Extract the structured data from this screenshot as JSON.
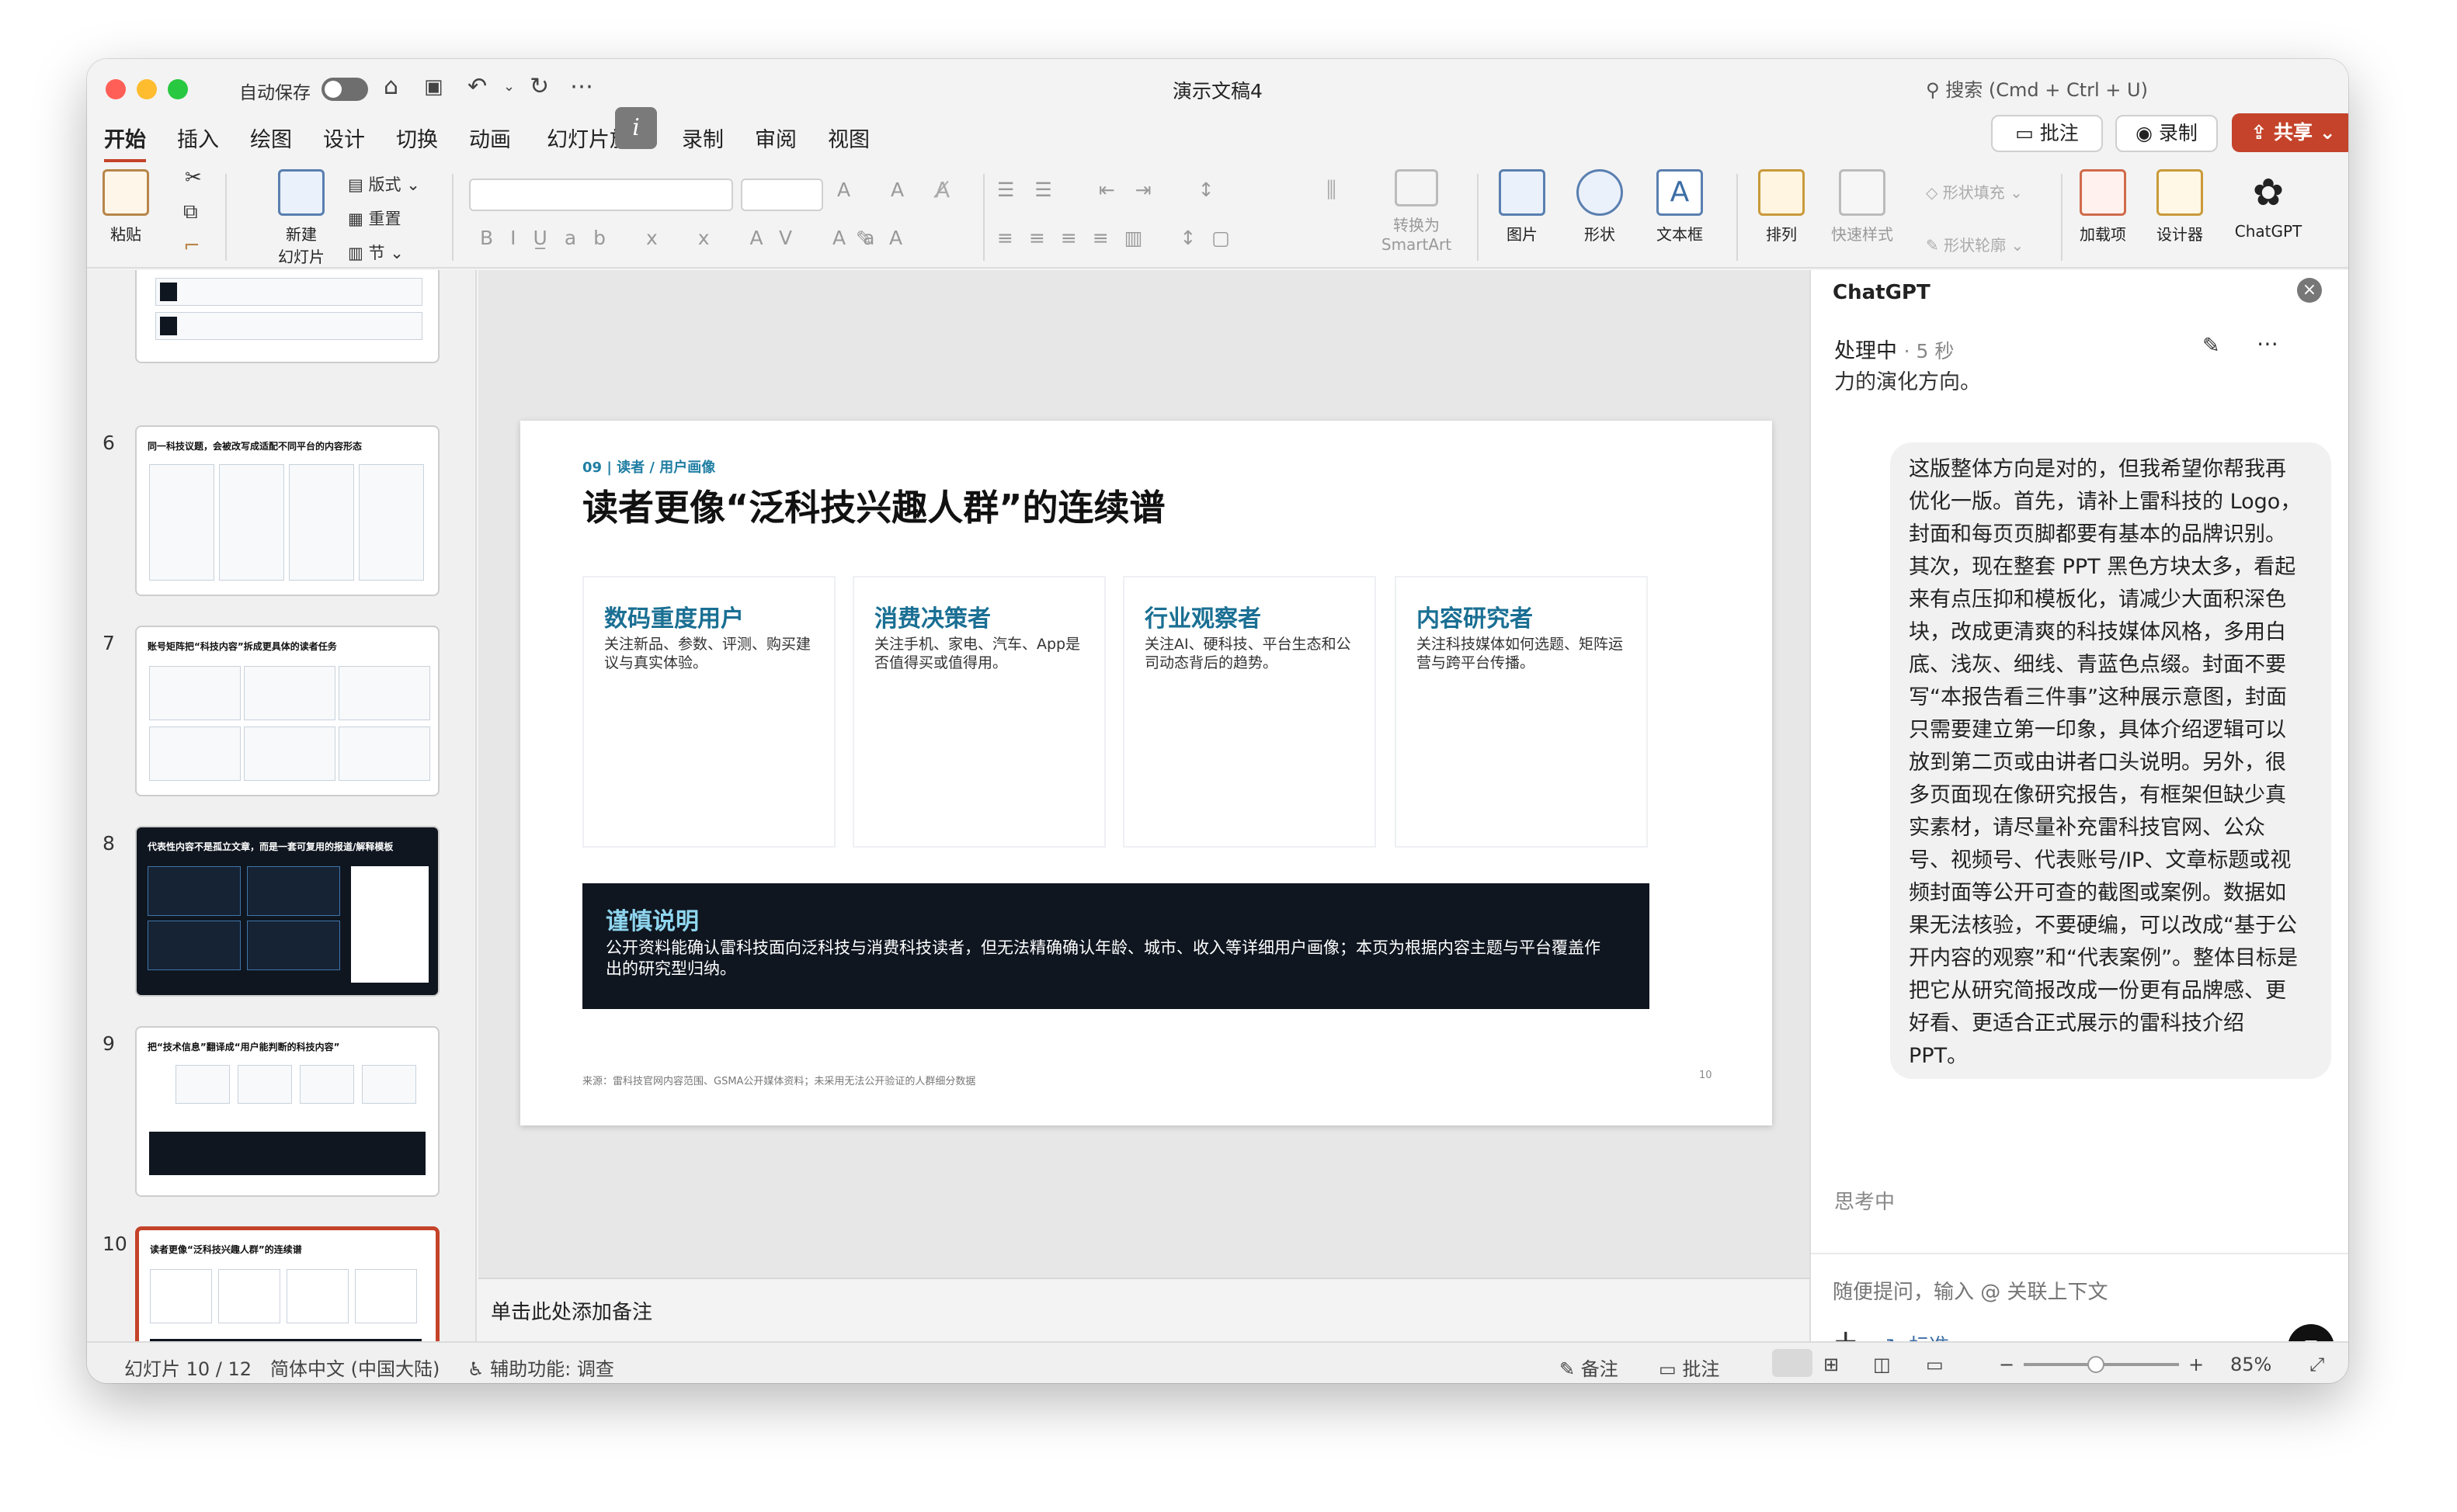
{
  "titlebar": {
    "autosave_label": "自动保存",
    "doc_title": "演示文稿4",
    "search_label": "搜索 (Cmd + Ctrl + U)"
  },
  "menu": {
    "tabs": [
      "开始",
      "插入",
      "绘图",
      "设计",
      "切换",
      "动画",
      "幻灯片放映",
      "录制",
      "审阅",
      "视图"
    ],
    "active_tab": "开始",
    "comment_label": "批注",
    "record_label": "录制",
    "share_label": "共享"
  },
  "ribbon": {
    "paste": "粘贴",
    "new_slide_line1": "新建",
    "new_slide_line2": "幻灯片",
    "layout": "版式",
    "reset": "重置",
    "section": "节",
    "convert_line1": "转换为",
    "convert_line2": "SmartArt",
    "picture": "图片",
    "shape": "形状",
    "textbox": "文本框",
    "arrange": "排列",
    "quick_styles": "快速样式",
    "shape_fill": "形状填充",
    "shape_outline": "形状轮廓",
    "addins": "加载项",
    "designer": "设计器",
    "chatgpt": "ChatGPT"
  },
  "thumbnails": [
    {
      "number": "",
      "title": ""
    },
    {
      "number": "6",
      "title": "同一科技议题，会被改写成适配不同平台的内容形态"
    },
    {
      "number": "7",
      "title": "账号矩阵把“科技内容”拆成更具体的读者任务"
    },
    {
      "number": "8",
      "title": "代表性内容不是孤立文章，而是一套可复用的报道/解释模板"
    },
    {
      "number": "9",
      "title": "把“技术信息”翻译成“用户能判断的科技内容”"
    },
    {
      "number": "10",
      "title": "读者更像“泛科技兴趣人群”的连续谱"
    }
  ],
  "slide": {
    "kicker": "09 | 读者 / 用户画像",
    "title": "读者更像“泛科技兴趣人群”的连续谱",
    "cards": [
      {
        "heading": "数码重度用户",
        "body": "关注新品、参数、评测、购买建议与真实体验。"
      },
      {
        "heading": "消费决策者",
        "body": "关注手机、家电、汽车、App是否值得买或值得用。"
      },
      {
        "heading": "行业观察者",
        "body": "关注AI、硬科技、平台生态和公司动态背后的趋势。"
      },
      {
        "heading": "内容研究者",
        "body": "关注科技媒体如何选题、矩阵运营与跨平台传播。"
      }
    ],
    "caution_heading": "谨慎说明",
    "caution_body": "公开资料能确认雷科技面向泛科技与消费科技读者，但无法精确确认年龄、城市、收入等详细用户画像；本页为根据内容主题与平台覆盖作出的研究型归纳。",
    "source": "来源：雷科技官网内容范围、GSMA公开媒体资料；未采用无法公开验证的人群细分数据",
    "page_number": "10"
  },
  "notes_placeholder": "单击此处添加备注",
  "chatgpt": {
    "title": "ChatGPT",
    "status": "处理中",
    "elapsed": "5 秒",
    "truncated_line": "力的演化方向。",
    "user_message": "这版整体方向是对的，但我希望你帮我再优化一版。首先，请补上雷科技的 Logo，封面和每页页脚都要有基本的品牌识别。其次，现在整套 PPT 黑色方块太多，看起来有点压抑和模板化，请减少大面积深色块，改成更清爽的科技媒体风格，多用白底、浅灰、细线、青蓝色点缀。封面不要写“本报告看三件事”这种展示意图，封面只需要建立第一印象，具体介绍逻辑可以放到第二页或由讲者口头说明。另外，很多页面现在像研究报告，有框架但缺少真实素材，请尽量补充雷科技官网、公众号、视频号、代表账号/IP、文章标题或视频封面等公开可查的截图或案例。数据如果无法核验，不要硬编，可以改成“基于公开内容的观察”和“代表案例”。整体目标是把它从研究简报改成一份更有品牌感、更好看、更适合正式展示的雷科技介绍PPT。",
    "thinking": "思考中",
    "input_placeholder": "随便提问，输入 @ 关联上下文",
    "mode_label": "标准"
  },
  "statusbar": {
    "slide_counter": "幻灯片 10 / 12",
    "language": "简体中文 (中国大陆)",
    "accessibility": "辅助功能: 调查",
    "notes": "备注",
    "comments": "批注",
    "zoom": "85%",
    "zoom_level": 0.85
  },
  "colors": {
    "accent": "#c4432a",
    "slide_heading": "#1a6f93",
    "dark_block": "#0f1620"
  }
}
